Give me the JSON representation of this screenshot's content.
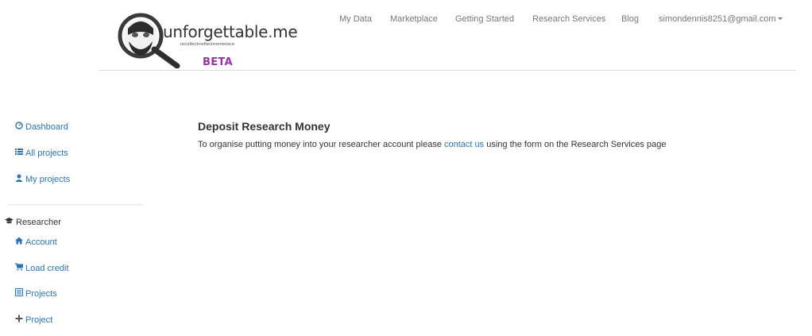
{
  "brand": {
    "wordmark_pre": "unforgettable",
    "wordmark_dot": ".",
    "wordmark_post": "me",
    "tagline": "recollect•reflect•reminisce",
    "badge": "BETA",
    "accent_color": "#9a32a4"
  },
  "topnav": {
    "items": [
      "My Data",
      "Marketplace",
      "Getting Started",
      "Research Services",
      "Blog"
    ],
    "user_email": "simondennis8251@gmail.com"
  },
  "sidebar": {
    "primary": [
      {
        "label": "Dashboard",
        "icon": "dashboard-icon"
      },
      {
        "label": "All projects",
        "icon": "list-icon"
      },
      {
        "label": "My projects",
        "icon": "user-icon"
      }
    ],
    "section_heading": "Researcher",
    "section_icon": "graduation-cap-icon",
    "secondary": [
      {
        "label": "Account",
        "icon": "home-icon"
      },
      {
        "label": "Load credit",
        "icon": "cart-icon"
      },
      {
        "label": "Projects",
        "icon": "list-alt-icon"
      },
      {
        "label": "Project",
        "icon": "plus-icon"
      }
    ],
    "link_color": "#2a73b8"
  },
  "main": {
    "title": "Deposit Research Money",
    "text_before": "To organise putting money into your researcher account please ",
    "link_text": "contact us",
    "text_after": " using the form on the Research Services page"
  }
}
